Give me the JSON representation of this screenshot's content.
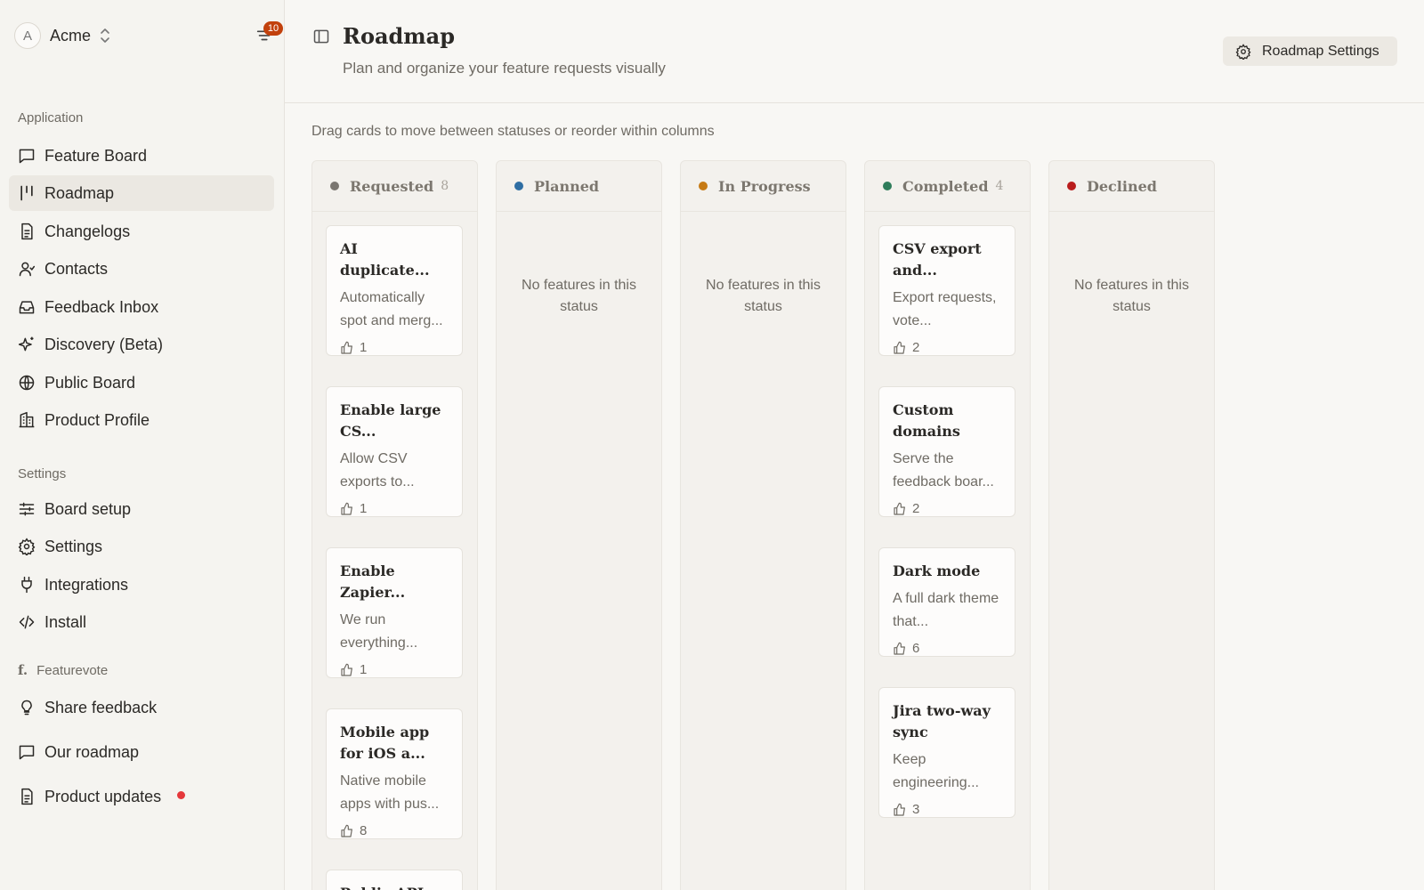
{
  "workspace": {
    "avatar_letter": "A",
    "name": "Acme",
    "notification_count": "10"
  },
  "sidebar": {
    "application_label": "Application",
    "application_items": [
      {
        "label": "Feature Board",
        "icon": "message-square-icon"
      },
      {
        "label": "Roadmap",
        "icon": "roadmap-icon",
        "active": true
      },
      {
        "label": "Changelogs",
        "icon": "file-text-icon"
      },
      {
        "label": "Contacts",
        "icon": "user-icon"
      },
      {
        "label": "Feedback Inbox",
        "icon": "inbox-icon"
      },
      {
        "label": "Discovery (Beta)",
        "icon": "sparkles-icon"
      },
      {
        "label": "Public Board",
        "icon": "globe-icon"
      },
      {
        "label": "Product Profile",
        "icon": "building-icon"
      }
    ],
    "settings_label": "Settings",
    "settings_items": [
      {
        "label": "Board setup",
        "icon": "sliders-icon"
      },
      {
        "label": "Settings",
        "icon": "gear-icon"
      },
      {
        "label": "Integrations",
        "icon": "plug-icon"
      },
      {
        "label": "Install",
        "icon": "code-icon"
      }
    ],
    "brand_label": "Featurevote",
    "brand_items": [
      {
        "label": "Share feedback",
        "icon": "lightbulb-icon"
      },
      {
        "label": "Our roadmap",
        "icon": "message-square-icon"
      },
      {
        "label": "Product updates",
        "icon": "file-text-icon",
        "unread": true
      }
    ]
  },
  "header": {
    "title": "Roadmap",
    "subtitle": "Plan and organize your feature requests visually",
    "settings_button": "Roadmap Settings"
  },
  "board": {
    "hint": "Drag cards to move between statuses or reorder within columns",
    "empty_text": "No features in this status",
    "columns": [
      {
        "name": "Requested",
        "count": "8",
        "color": "#7a7670",
        "cards": [
          {
            "title": "AI duplicate...",
            "desc": "Automatically spot and merg...",
            "votes": "1"
          },
          {
            "title": "Enable large CS...",
            "desc": "Allow CSV exports to...",
            "votes": "1"
          },
          {
            "title": "Enable Zapier...",
            "desc": "We run everything...",
            "votes": "1"
          },
          {
            "title": "Mobile app for iOS a...",
            "desc": "Native mobile apps with pus...",
            "votes": "8"
          },
          {
            "title": "Public API",
            "desc": "",
            "votes": ""
          }
        ]
      },
      {
        "name": "Planned",
        "count": "",
        "color": "#2f6ea3",
        "cards": []
      },
      {
        "name": "In Progress",
        "count": "",
        "color": "#c67a14",
        "cards": []
      },
      {
        "name": "Completed",
        "count": "4",
        "color": "#2f7d5b",
        "cards": [
          {
            "title": "CSV export and...",
            "desc": "Export requests, vote...",
            "votes": "2"
          },
          {
            "title": "Custom domains",
            "desc": "Serve the feedback boar...",
            "votes": "2"
          },
          {
            "title": "Dark mode",
            "desc": "A full dark theme that...",
            "votes": "6"
          },
          {
            "title": "Jira two-way sync",
            "desc": "Keep engineering...",
            "votes": "3"
          }
        ]
      },
      {
        "name": "Declined",
        "count": "",
        "color": "#b91c1c",
        "cards": []
      }
    ]
  }
}
